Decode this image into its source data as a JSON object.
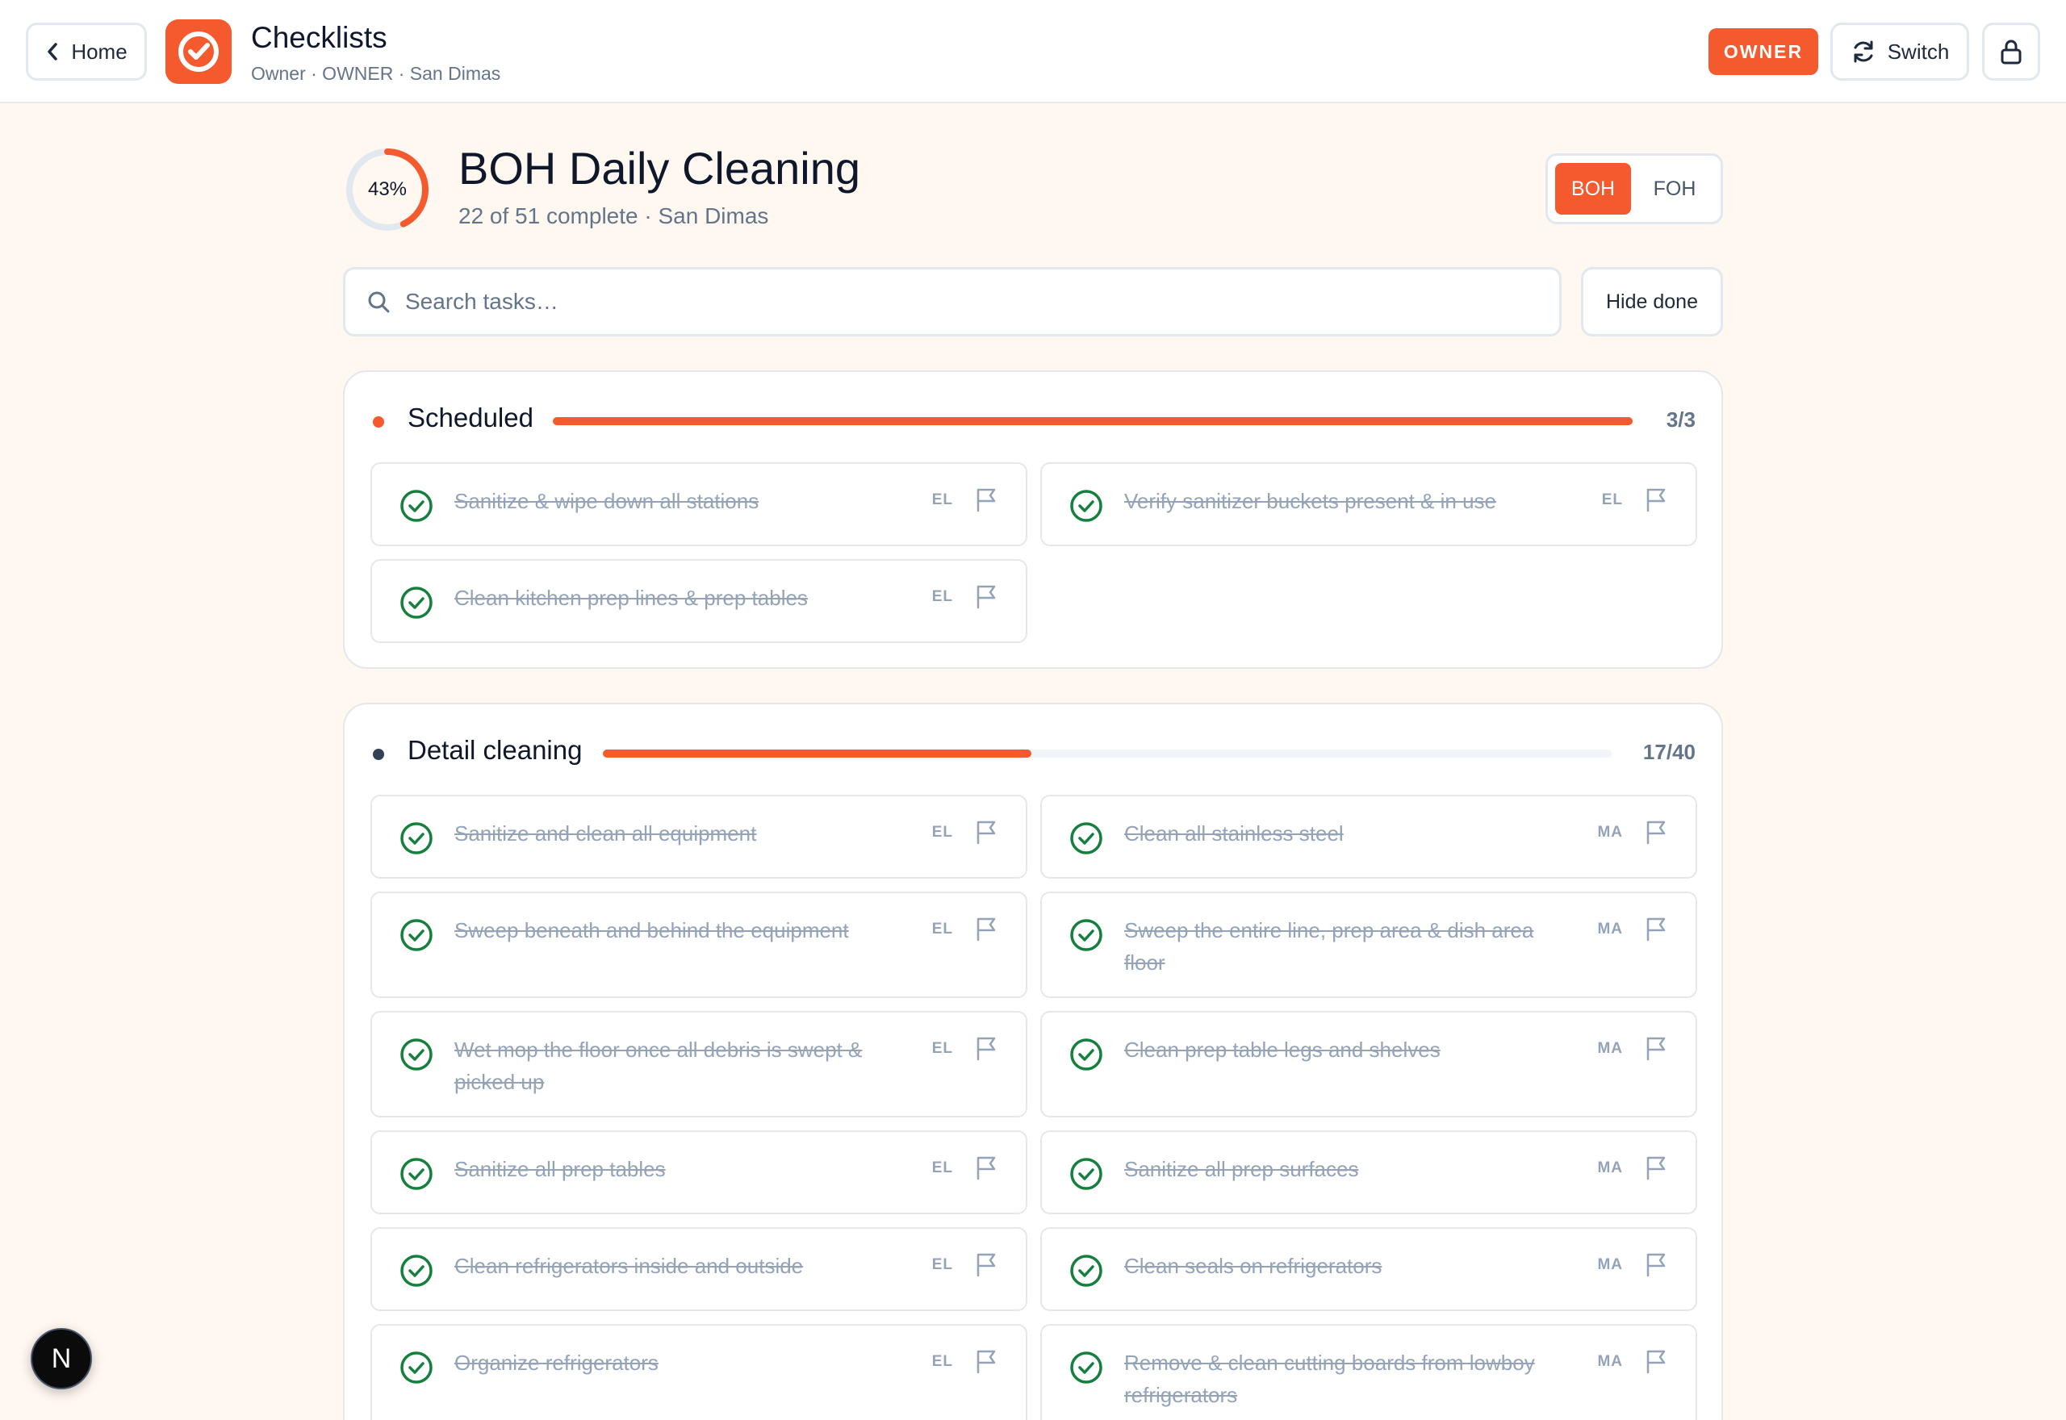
{
  "topbar": {
    "home_label": "Home",
    "app_title": "Checklists",
    "app_subtitle": "Owner · OWNER · San Dimas",
    "role_badge": "OWNER",
    "switch_label": "Switch",
    "brand_color": "#f45a2e"
  },
  "header": {
    "progress_label": "43%",
    "progress_value": 43,
    "title": "BOH Daily Cleaning",
    "subtitle": "22 of 51 complete · San Dimas",
    "areas": [
      {
        "label": "BOH",
        "active": true
      },
      {
        "label": "FOH",
        "active": false
      }
    ]
  },
  "search": {
    "placeholder": "Search tasks…",
    "value": ""
  },
  "hide_done_label": "Hide done",
  "sections": [
    {
      "title": "Scheduled",
      "count": "3/3",
      "done": 3,
      "total": 3,
      "dot_color": "#f45a2e",
      "tasks": [
        {
          "label": "Sanitize & wipe down all stations",
          "initials": "EL",
          "done": true
        },
        {
          "label": "Verify sanitizer buckets present & in use",
          "initials": "EL",
          "done": true
        },
        {
          "label": "Clean kitchen prep lines & prep tables",
          "initials": "EL",
          "done": true
        }
      ]
    },
    {
      "title": "Detail cleaning",
      "count": "17/40",
      "done": 17,
      "total": 40,
      "dot_color": "#334155",
      "tasks": [
        {
          "label": "Sanitize and clean all equipment",
          "initials": "EL",
          "done": true
        },
        {
          "label": "Clean all stainless steel",
          "initials": "MA",
          "done": true
        },
        {
          "label": "Sweep beneath and behind the equipment",
          "initials": "EL",
          "done": true
        },
        {
          "label": "Sweep the entire line, prep area & dish area floor",
          "initials": "MA",
          "done": true
        },
        {
          "label": "Wet mop the floor once all debris is swept & picked up",
          "initials": "EL",
          "done": true
        },
        {
          "label": "Clean prep table legs and shelves",
          "initials": "MA",
          "done": true
        },
        {
          "label": "Sanitize all prep tables",
          "initials": "EL",
          "done": true
        },
        {
          "label": "Sanitize all prep surfaces",
          "initials": "MA",
          "done": true
        },
        {
          "label": "Clean refrigerators inside and outside",
          "initials": "EL",
          "done": true
        },
        {
          "label": "Clean seals on refrigerators",
          "initials": "MA",
          "done": true
        },
        {
          "label": "Organize refrigerators",
          "initials": "EL",
          "done": true
        },
        {
          "label": "Remove & clean cutting boards from lowboy refrigerators",
          "initials": "MA",
          "done": true
        }
      ]
    }
  ],
  "dev_badge": "N",
  "icons": {
    "back": "chevron-left-icon",
    "logo": "check-circle-icon",
    "switch": "refresh-icon",
    "lock": "lock-icon",
    "search": "search-icon",
    "task_check": "check-circle-icon",
    "flag": "flag-icon"
  }
}
